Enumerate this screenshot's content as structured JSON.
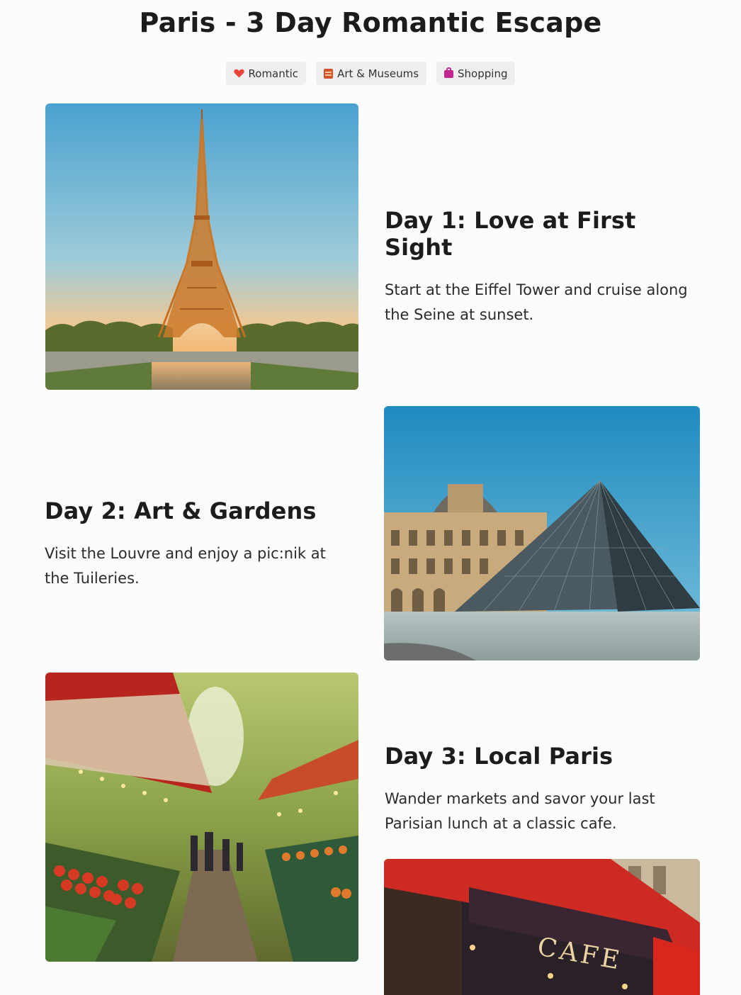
{
  "page": {
    "title": "Paris - 3 Day Romantic Escape"
  },
  "tags": [
    {
      "label": "Romantic",
      "icon": "heart-icon",
      "color": "#e8453c"
    },
    {
      "label": "Art & Museums",
      "icon": "museum-icon",
      "color": "#d2552a"
    },
    {
      "label": "Shopping",
      "icon": "shopping-bag-icon",
      "color": "#c2278f"
    }
  ],
  "days": [
    {
      "title": "Day 1: Love at First Sight",
      "description": "Start at the Eiffel Tower and cruise along the Seine at sunset.",
      "image": "eiffel-tower-photo"
    },
    {
      "title": "Day 2: Art & Gardens",
      "description": "Visit the Louvre and enjoy a pic:nik at the Tuileries.",
      "image": "louvre-pyramid-photo"
    },
    {
      "title": "Day 3: Local Paris",
      "description": "Wander markets and savor your last Parisian lunch at a classic cafe.",
      "image": "street-market-photo"
    }
  ],
  "cafe_sign": "CAFE"
}
